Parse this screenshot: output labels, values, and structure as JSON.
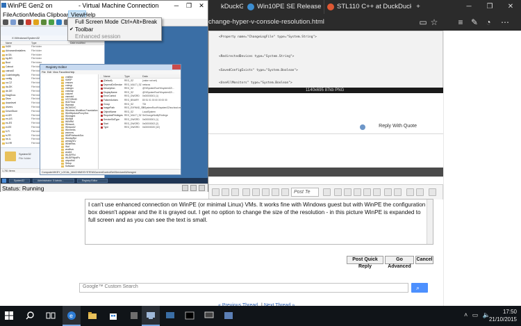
{
  "browser": {
    "tabs": [
      {
        "label": "kDuckGo"
      },
      {
        "label": "Win10PE SE Release"
      },
      {
        "label": "STL110 C++ at DuckDuckGo"
      }
    ],
    "url": "change-hyper-v-console-resolution.html",
    "code_caption": "1140x695 87kb PNG",
    "reply_with_quote": "Reply With Quote",
    "post_text_dropdown": "Post Te",
    "editor_text": "I can't use enhanced connection on WinPE (or minimal Linux) VMs.  It works fine with Windows guest but with WinPE the configuration box doesn't appear and the it is grayed out.  I get no option to change the size of the resolution - in this picture WinPE is expanded to full screen and as you can see the text is small.",
    "buttons": {
      "post_quick_reply": "Post Quick Reply",
      "go_advanced": "Go Advanced",
      "cancel": "Cancel"
    },
    "search_placeholder": "Custom Search",
    "search_brand": "Google™",
    "thread_nav": {
      "previous": "« Previous Thread",
      "separator": "|",
      "next": "Next Thread »"
    },
    "code_lines": [
      "<Property name=\"ChangeLogFile\" type=\"System.String\">",
      "<RedirectedDevices type=\"System.String\">",
      "<SavedConfigExists\" type=\"System.Boolean\">",
      "<UseAllMonitors\" type=\"System.Boolean\">"
    ]
  },
  "vm": {
    "title": "WinPE Gen2 on",
    "title_suffix": "- Virtual Machine Connection",
    "menu": [
      "File",
      "Action",
      "Media",
      "Clipboard",
      "View",
      "Help"
    ],
    "active_menu": "View",
    "status": "Status: Running",
    "view_menu": [
      {
        "label": "Full Screen Mode",
        "shortcut": "Ctrl+Alt+Break",
        "checked": false,
        "enabled": true
      },
      {
        "label": "Toolbar",
        "shortcut": "",
        "checked": true,
        "enabled": true
      },
      {
        "label": "Enhanced session",
        "shortcut": "",
        "checked": false,
        "enabled": false
      }
    ]
  },
  "explorer": {
    "address": "X:\\Windows\\System32",
    "headers": [
      "Name",
      "Type",
      "Date modified"
    ],
    "rows": [
      {
        "name": "0409",
        "type": "File folder"
      },
      {
        "name": "AdvancedInstallers",
        "type": "File folder"
      },
      {
        "name": "ar-SA",
        "type": "File folder"
      },
      {
        "name": "bg-BG",
        "type": "File folder"
      },
      {
        "name": "Boot",
        "type": "File folder"
      },
      {
        "name": "Catroot",
        "type": "File folder"
      },
      {
        "name": "catroot2",
        "type": "File folder"
      },
      {
        "name": "CodeIntegrity",
        "type": "File folder"
      },
      {
        "name": "config",
        "type": "File folder"
      },
      {
        "name": "cs-CZ",
        "type": "File folder"
      },
      {
        "name": "da-DK",
        "type": "File folder"
      },
      {
        "name": "de-DE",
        "type": "File folder"
      },
      {
        "name": "DiagSvcs",
        "type": "File folder"
      },
      {
        "name": "Dism",
        "type": "File folder"
      },
      {
        "name": "downlevel",
        "type": "File folder"
      },
      {
        "name": "drivers",
        "type": "File folder"
      },
      {
        "name": "DriverStore",
        "type": "File folder"
      },
      {
        "name": "el-GR",
        "type": "File folder"
      },
      {
        "name": "en-US",
        "type": "File folder"
      },
      {
        "name": "es-ES",
        "type": "File folder"
      },
      {
        "name": "et-EE",
        "type": "File folder"
      },
      {
        "name": "fi-FI",
        "type": "File folder"
      },
      {
        "name": "fr-FR",
        "type": "File folder"
      },
      {
        "name": "he-IL",
        "type": "File folder"
      },
      {
        "name": "hr-HR",
        "type": "File folder"
      }
    ],
    "selected_name": "System32",
    "selected_type": "File folder",
    "status": "1,781 items"
  },
  "regedit": {
    "title": "Registry Editor",
    "menu": [
      "File",
      "Edit",
      "View",
      "Favorites",
      "Help"
    ],
    "tree": [
      "vmfilter",
      "VMSP",
      "vmusrs",
      "volmgr",
      "volmgrx",
      "volsnap",
      "volume",
      "vsmraid",
      "VSTXRAID",
      "W32Time",
      "Wamstd",
      "WCMSVC",
      "Windows Workflow Foundation",
      "WinHttpAutoProxySvc",
      "Winmgmt",
      "WinNat",
      "WINRM",
      "Winsock",
      "Winsock2",
      "WinVerbs",
      "wsmvnv",
      "WMPNetworkSvc",
      "WmiApRpl",
      "wmiApSrv",
      "WNetRes",
      "Wof",
      "wudfsvc",
      "wudrd",
      "WUDFRd",
      "WUDFWpdFs",
      "xinputhid",
      "Setup",
      "Software"
    ],
    "headers": [
      "Name",
      "Type",
      "Data"
    ],
    "values": [
      {
        "name": "(Default)",
        "type": "REG_SZ",
        "data": "(value not set)"
      },
      {
        "name": "DependOnService",
        "type": "REG_MULTI_SZ",
        "data": "netsvcs"
      },
      {
        "name": "Description",
        "type": "REG_SZ",
        "data": "@%SystemRoot%\\system32\\..."
      },
      {
        "name": "DisplayName",
        "type": "REG_SZ",
        "data": "@%SystemRoot%\\system32\\..."
      },
      {
        "name": "ErrorControl",
        "type": "REG_DWORD",
        "data": "0x00000001 (1)"
      },
      {
        "name": "FailureActions",
        "type": "REG_BINARY",
        "data": "80 51 01 00 00 00 00 00"
      },
      {
        "name": "Group",
        "type": "REG_SZ",
        "data": "TDI"
      },
      {
        "name": "ImagePath",
        "type": "REG_EXPAND_SZ",
        "data": "%SystemRoot%\\system32\\svchost.exe"
      },
      {
        "name": "ObjectName",
        "type": "REG_SZ",
        "data": "LocalSystem"
      },
      {
        "name": "RequiredPrivileges",
        "type": "REG_MULTI_SZ",
        "data": "SeChangeNotifyPrivilege"
      },
      {
        "name": "ServiceSidType",
        "type": "REG_DWORD",
        "data": "0x00000001 (1)"
      },
      {
        "name": "Start",
        "type": "REG_DWORD",
        "data": "0x00000002 (2)"
      },
      {
        "name": "Type",
        "type": "REG_DWORD",
        "data": "0x00000020 (32)"
      }
    ],
    "status": "Computer\\HKEY_LOCAL_MACHINE\\SYSTEM\\CurrentControlSet\\Services\\Winmgmt"
  },
  "vm_taskbar": [
    "System32",
    "Administrator: X:\\windo...",
    "Registry Editor"
  ],
  "taskbar": {
    "time": "17:50",
    "date": "21/10/2015"
  },
  "colors": {
    "edge_chrome": "#2b2b2b",
    "taskbar": "#101418",
    "vm_desktop": "#3a6ea5",
    "menu_highlight": "#cce4f7",
    "search_button": "#4d90fe"
  }
}
